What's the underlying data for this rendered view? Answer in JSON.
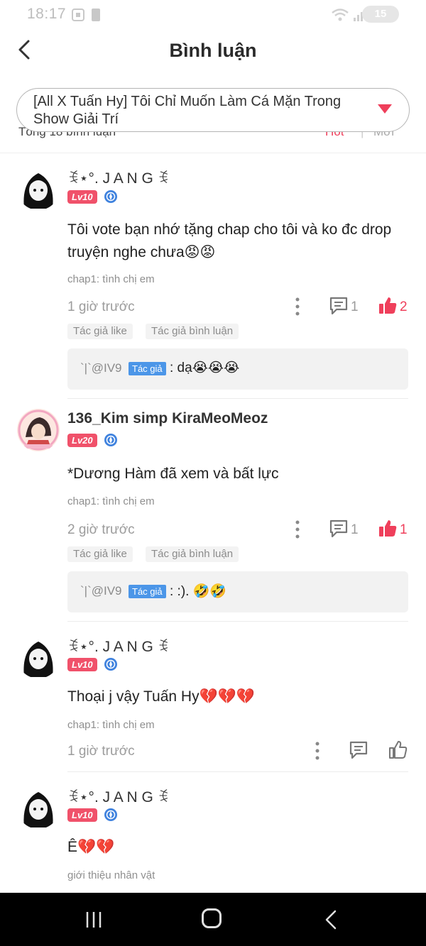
{
  "status_bar": {
    "time": "18:17",
    "battery": "15"
  },
  "header": {
    "title": "Bình luận"
  },
  "chapter_select": {
    "value": "[All X Tuấn Hy] Tôi Chỉ Muốn Làm Cá Mặn Trong Show Giải Trí"
  },
  "summary": {
    "total_label": "Tổng 18 bình luận",
    "sort_hot": "Hot",
    "sort_separator": "|",
    "sort_new": "Mới"
  },
  "comments": [
    {
      "username": "ꉂ⋆°. J A N G ꉂ",
      "level": "Lv10",
      "text": "Tôi vote bạn nhớ tặng chap cho tôi và ko đc drop truyện nghe chưa😡😡",
      "chapter": "chap1: tình chị em",
      "time": "1 giờ trước",
      "reply_count": "1",
      "like_count": "2",
      "tags": [
        "Tác giả like",
        "Tác giả bình luận"
      ],
      "reply": {
        "name": "`|`@IV9",
        "badge": "Tác giả",
        "text": ": dạ😭😭😭"
      }
    },
    {
      "username": "136_Kim simp KiraMeoMeoz",
      "level": "Lv20",
      "text": "*Dương Hàm đã xem và bất lực",
      "chapter": "chap1: tình chị em",
      "time": "2 giờ trước",
      "reply_count": "1",
      "like_count": "1",
      "tags": [
        "Tác giả like",
        "Tác giả bình luận"
      ],
      "reply": {
        "name": "`|`@IV9",
        "badge": "Tác giả",
        "text": ": :). 🤣🤣"
      }
    },
    {
      "username": "ꉂ⋆°. J A N G ꉂ",
      "level": "Lv10",
      "text": "Thoại j vậy Tuấn Hy💔💔💔",
      "chapter": "chap1: tình chị em",
      "time": "1 giờ trước"
    },
    {
      "username": "ꉂ⋆°. J A N G ꉂ",
      "level": "Lv10",
      "text": "Ê💔💔",
      "chapter": "giới thiệu nhân vật"
    }
  ],
  "colors": {
    "accent": "#ef3f5b",
    "level_badge": "#f0516a",
    "author_badge": "#4c96e8",
    "verify": "#3f82de"
  }
}
